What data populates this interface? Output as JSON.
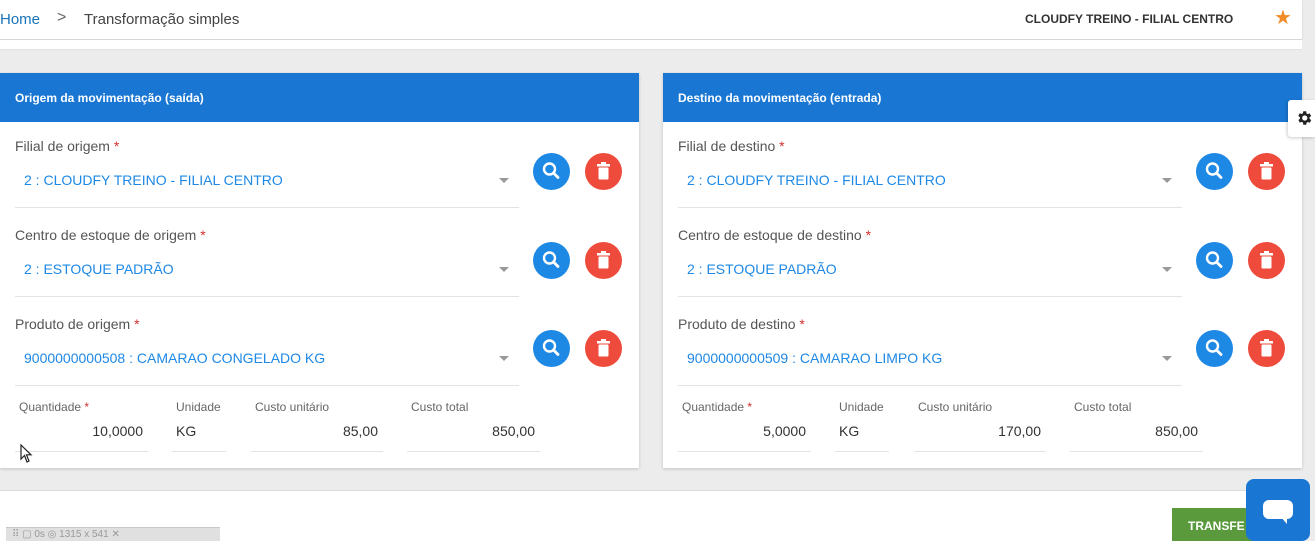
{
  "breadcrumb": {
    "home": "Home",
    "separator": ">",
    "current": "Transformação simples"
  },
  "header": {
    "company": "CLOUDFY TREINO - FILIAL CENTRO",
    "favorite_icon": "star-icon",
    "accent_color": "#f28c28"
  },
  "origin": {
    "title": "Origem da movimentação (saída)",
    "branch": {
      "label": "Filial de origem",
      "required": "*",
      "value": "2 : CLOUDFY TREINO - FILIAL CENTRO"
    },
    "stock_center": {
      "label": "Centro de estoque de origem",
      "required": "*",
      "value": "2 : ESTOQUE PADRÃO"
    },
    "product": {
      "label": "Produto de origem",
      "required": "*",
      "value": "9000000000508 : CAMARAO CONGELADO KG"
    },
    "quantity": {
      "label": "Quantidade",
      "required": "*",
      "value": "10,0000"
    },
    "unit": {
      "label": "Unidade",
      "value": "KG"
    },
    "unit_cost": {
      "label": "Custo unitário",
      "value": "85,00"
    },
    "total_cost": {
      "label": "Custo total",
      "value": "850,00"
    }
  },
  "destination": {
    "title": "Destino da movimentação (entrada)",
    "branch": {
      "label": "Filial de destino",
      "required": "*",
      "value": "2 : CLOUDFY TREINO - FILIAL CENTRO"
    },
    "stock_center": {
      "label": "Centro de estoque de destino",
      "required": "*",
      "value": "2 : ESTOQUE PADRÃO"
    },
    "product": {
      "label": "Produto de destino",
      "required": "*",
      "value": "9000000000509 : CAMARAO LIMPO KG"
    },
    "quantity": {
      "label": "Quantidade",
      "required": "*",
      "value": "5,0000"
    },
    "unit": {
      "label": "Unidade",
      "value": "KG"
    },
    "unit_cost": {
      "label": "Custo unitário",
      "value": "170,00"
    },
    "total_cost": {
      "label": "Custo total",
      "value": "850,00"
    }
  },
  "actions": {
    "transfer_label": "TRANSFE"
  },
  "status_bar": {
    "text": "⠿ ▢ 0s ◎ 1315 x 541 ✕"
  },
  "colors": {
    "panel_header": "#1976d2",
    "search_button": "#1e88e5",
    "delete_button": "#ef4b3c",
    "transfer_button": "#5b9a3c"
  }
}
